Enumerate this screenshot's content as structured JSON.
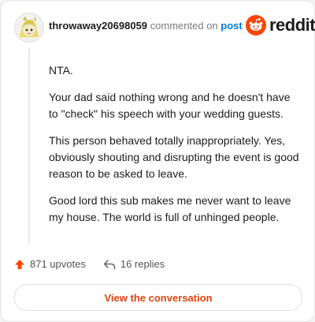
{
  "comment": {
    "username": "throwaway20698059",
    "action_text": "commented on",
    "post_link": "post",
    "paragraphs": [
      "NTA.",
      "Your dad said nothing wrong and he doesn't have to \"check\" his speech with your wedding guests.",
      "This person behaved totally inappropriately. Yes, obviously shouting and disrupting the event is good reason to be asked to leave.",
      "Good lord this sub makes me never want to leave my house. The world is full of unhinged people."
    ]
  },
  "brand": {
    "wordmark": "reddit",
    "color": "#ff4500"
  },
  "footer": {
    "upvotes": "871 upvotes",
    "replies": "16 replies",
    "upvote_icon": "upvote-arrow-icon",
    "reply_icon": "reply-icon"
  },
  "cta": {
    "label": "View the conversation"
  }
}
